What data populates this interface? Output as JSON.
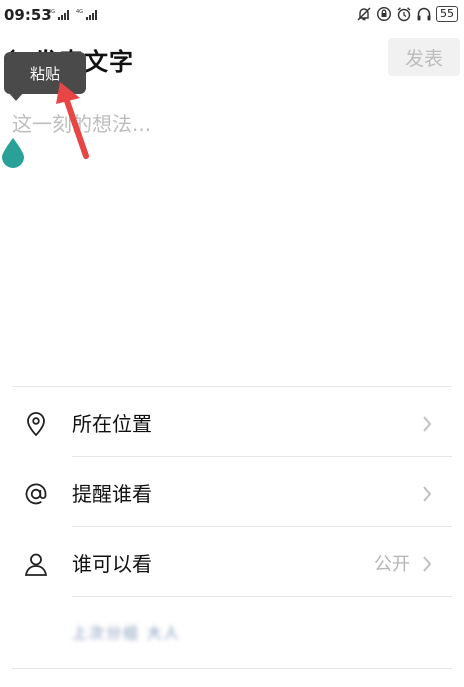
{
  "status_bar": {
    "time": "09:53",
    "signal_1": "4G",
    "signal_2": "4G",
    "battery": "55"
  },
  "header": {
    "title": "发表文字",
    "publish_label": "发表"
  },
  "tooltip": {
    "paste_label": "粘贴"
  },
  "editor": {
    "placeholder": "这一刻的想法..."
  },
  "options": [
    {
      "label": "所在位置",
      "icon": "location-pin-icon"
    },
    {
      "label": "提醒谁看",
      "icon": "at-icon"
    },
    {
      "label": "谁可以看",
      "value": "公开",
      "icon": "person-icon"
    }
  ],
  "blurred_text": "上次分组 大人",
  "colors": {
    "accent_handle": "#2aa198",
    "annotation_arrow": "#e84545",
    "tooltip_bg": "#4a4a4a"
  }
}
